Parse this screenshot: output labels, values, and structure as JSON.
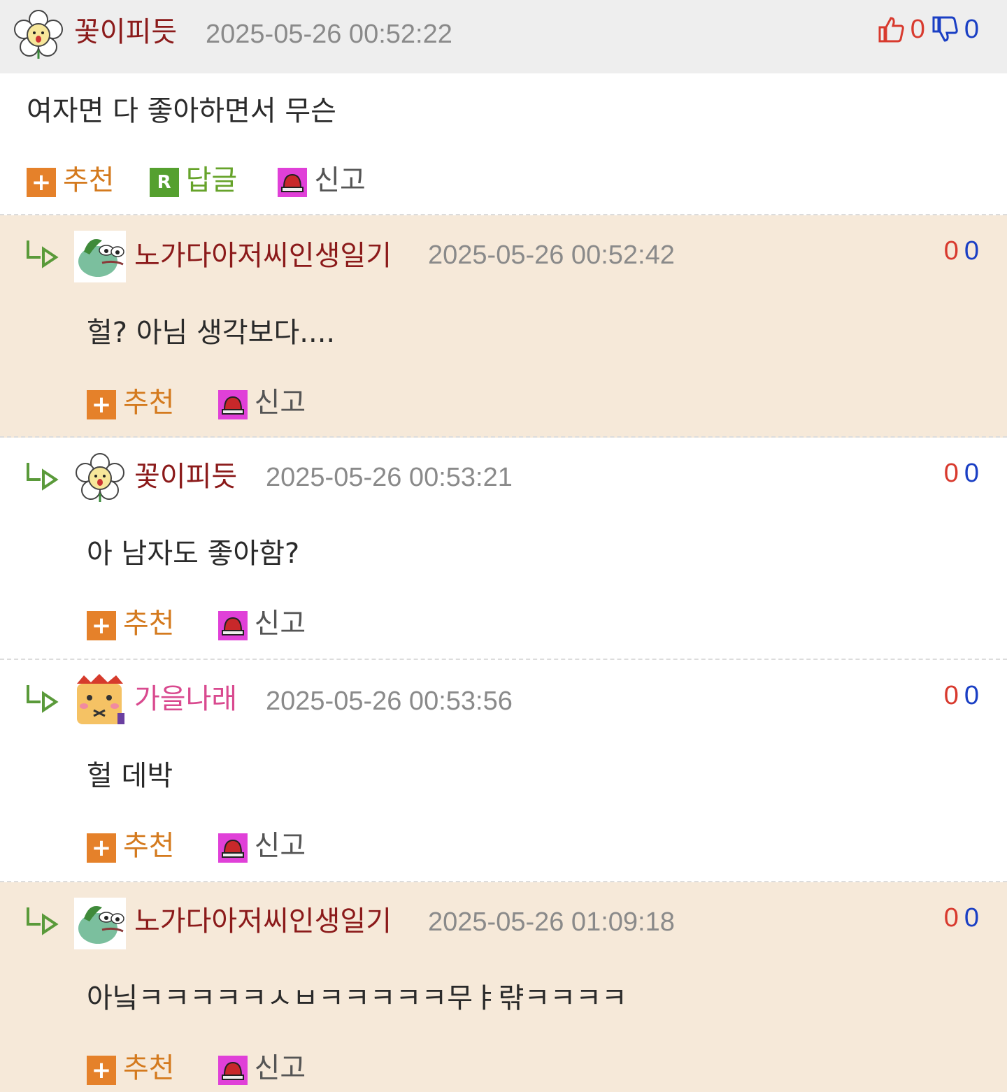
{
  "main_comment": {
    "nickname": "꽃이피듯",
    "timestamp": "2025-05-26 00:52:22",
    "text": "여자면 다 좋아하면서 무슨",
    "likes": "0",
    "dislikes": "0",
    "avatar_icon": "flower-avatar-icon",
    "nick_color": "#8b1a1a",
    "actions": {
      "recommend": "추천",
      "reply": "답글",
      "report": "신고"
    }
  },
  "replies": [
    {
      "nickname": "노가다아저씨인생일기",
      "timestamp": "2025-05-26 00:52:42",
      "text": "헐? 아님 생각보다....",
      "likes": "0",
      "dislikes": "0",
      "avatar_icon": "frog-avatar-icon",
      "nick_color": "#8b1a1a",
      "bg": "#f6e9d9",
      "actions": {
        "recommend": "추천",
        "report": "신고"
      }
    },
    {
      "nickname": "꽃이피듯",
      "timestamp": "2025-05-26 00:53:21",
      "text": "아 남자도 좋아함?",
      "likes": "0",
      "dislikes": "0",
      "avatar_icon": "flower-avatar-icon",
      "nick_color": "#8b1a1a",
      "bg": "#ffffff",
      "actions": {
        "recommend": "추천",
        "report": "신고"
      }
    },
    {
      "nickname": "가을나래",
      "timestamp": "2025-05-26 00:53:56",
      "text": "헐 데박",
      "likes": "0",
      "dislikes": "0",
      "avatar_icon": "bear-avatar-icon",
      "nick_color": "#d94a8f",
      "bg": "#ffffff",
      "actions": {
        "recommend": "추천",
        "report": "신고"
      }
    },
    {
      "nickname": "노가다아저씨인생일기",
      "timestamp": "2025-05-26 01:09:18",
      "text": "아닠ㅋㅋㅋㅋㅋㅅㅂㅋㅋㅋㅋㅋ무ㅑ랶ㅋㅋㅋㅋ",
      "likes": "0",
      "dislikes": "0",
      "avatar_icon": "frog-avatar-icon",
      "nick_color": "#8b1a1a",
      "bg": "#f6e9d9",
      "actions": {
        "recommend": "추천",
        "report": "신고"
      }
    }
  ]
}
